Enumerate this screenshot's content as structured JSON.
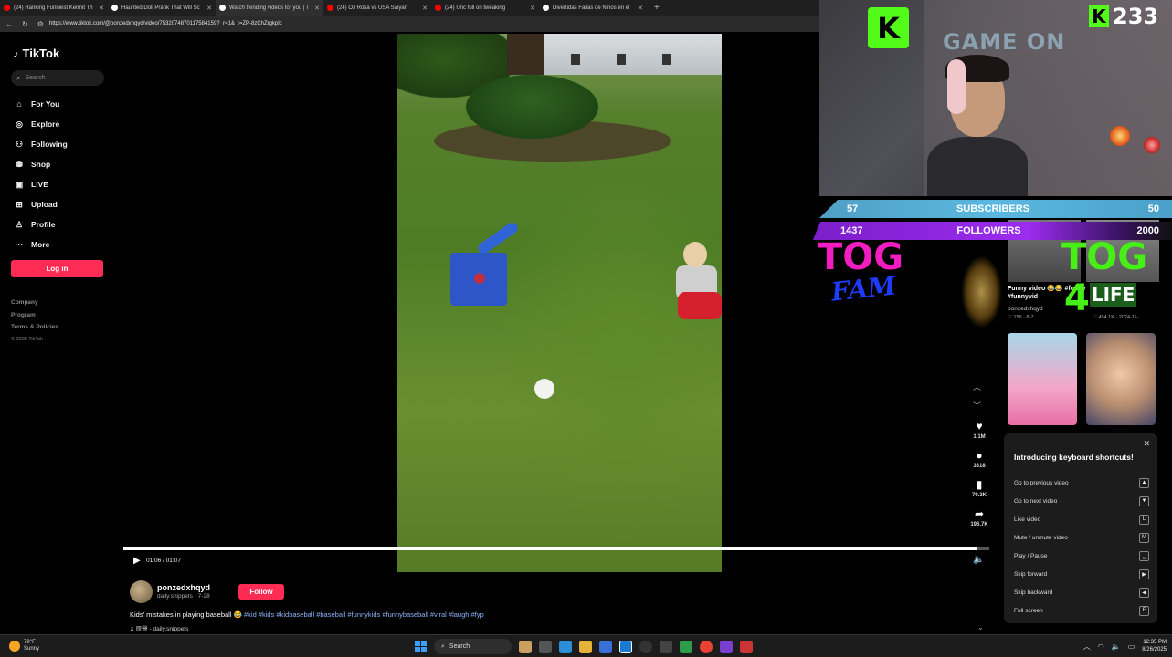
{
  "browser": {
    "tabs": [
      {
        "title": "(24) Ranking Funniest Kermit Th",
        "color": "#ff0000",
        "active": false
      },
      {
        "title": "Haunted Doll Prank That Will Sc",
        "color": "#ffffff",
        "active": false
      },
      {
        "title": "Watch trending videos for you | T",
        "color": "#ffffff",
        "active": true
      },
      {
        "title": "(24) OJ Rosá vs USA Saiyan",
        "color": "#ff0000",
        "active": false
      },
      {
        "title": "(24) Unc full on tweaking",
        "color": "#ff0000",
        "active": false
      },
      {
        "title": "Divertidas Fallas de Niños en el",
        "color": "#ffffff",
        "active": false
      }
    ],
    "new_tab": "+",
    "url": "https://www.tiktok.com/@ponzedxhqyd/video/7532074870117584159?_r=1&_t=ZP-8zChZrgkplc"
  },
  "tiktok": {
    "logo": "TikTok",
    "search_placeholder": "Search",
    "nav": [
      {
        "label": "For You",
        "icon": "home-icon",
        "glyph": "⌂"
      },
      {
        "label": "Explore",
        "icon": "compass-icon",
        "glyph": "◎"
      },
      {
        "label": "Following",
        "icon": "following-icon",
        "glyph": "⚇"
      },
      {
        "label": "Shop",
        "icon": "shop-bag-icon",
        "glyph": "⛃"
      },
      {
        "label": "LIVE",
        "icon": "live-icon",
        "glyph": "▣"
      },
      {
        "label": "Upload",
        "icon": "upload-icon",
        "glyph": "⊞"
      },
      {
        "label": "Profile",
        "icon": "profile-icon",
        "glyph": "♙"
      },
      {
        "label": "More",
        "icon": "more-icon",
        "glyph": "···"
      }
    ],
    "login": "Log in",
    "footer": {
      "company": "Company",
      "program": "Program",
      "terms": "Terms & Policies",
      "copyright": "© 2025 TikTok"
    }
  },
  "video": {
    "time": "01:06 / 01:07",
    "progress": 0.985,
    "likes": "1.1M",
    "comments": "3318",
    "saves": "79.3K",
    "shares": "196.7K",
    "author": "ponzedxhqyd",
    "author_sub": "daily.snippets · 7-28",
    "follow": "Follow",
    "caption_text": "Kids' mistakes in playing baseball 😂 ",
    "caption_tags": "#kid #kids #kidbaseball #baseball #funnykids #funnybaseball #viral #laugh #fyp",
    "music": "♫ 原聲 - daily.snippets"
  },
  "recommendations": {
    "title": "Funny video 😂😂 #funny #funnyvid",
    "user": "ponzedxhqyd",
    "stats1": "♡ 156 · 8-7",
    "stats2": "♡ 454.1K · 2024-11-..."
  },
  "shortcuts": {
    "title": "Introducing keyboard shortcuts!",
    "close": "✕",
    "items": [
      {
        "label": "Go to previous video",
        "key": "▲"
      },
      {
        "label": "Go to next video",
        "key": "▼"
      },
      {
        "label": "Like video",
        "key": "L"
      },
      {
        "label": "Mute / unmute video",
        "key": "M"
      },
      {
        "label": "Play / Pause",
        "key": "␣"
      },
      {
        "label": "Skip forward",
        "key": "▶"
      },
      {
        "label": "Skip backward",
        "key": "◀"
      },
      {
        "label": "Full screen",
        "key": "F"
      }
    ]
  },
  "overlay": {
    "viewer_count": "233",
    "game_on": "GAME ON",
    "subs_current": "57",
    "subs_label": "SUBSCRIBERS",
    "subs_goal": "50",
    "followers_current": "1437",
    "followers_label": "FOLLOWERS",
    "followers_goal": "2000",
    "tog": "TOG",
    "fam": "FAM",
    "tog4": "TOG",
    "four": "4",
    "life": "LIFE"
  },
  "taskbar": {
    "temp": "79°F",
    "weather": "Sunny",
    "search": "Search",
    "time": "12:35 PM",
    "date": "8/26/2025"
  }
}
